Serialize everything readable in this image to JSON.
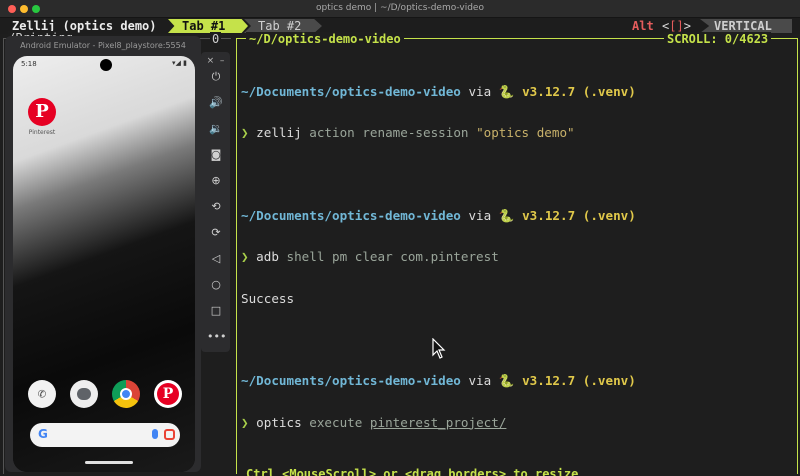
{
  "window": {
    "title": "optics demo | ~/D/optics-demo-video"
  },
  "zellij": {
    "session": "Zellij (optics demo)",
    "tabs": [
      {
        "label": "Tab #1",
        "active": true
      },
      {
        "label": "Tab #2",
        "active": false
      }
    ],
    "alt_label": "Alt",
    "alt_bracket_open": "<",
    "alt_bracket_inner": "[]",
    "alt_bracket_close": ">",
    "mode": "VERTICAL"
  },
  "left_pane": {
    "title": "/Printing",
    "zero": "0"
  },
  "emulator": {
    "title": "Android Emulator - Pixel8_playstore:5554",
    "time": "5:18",
    "status_right": "▾◢ ▮",
    "app_label": "Pinterest",
    "close": "×",
    "minimize": "–"
  },
  "terminal": {
    "pane_title": "~/D/optics-demo-video",
    "scroll": "SCROLL:  0/4623",
    "footer": "Ctrl <MouseScroll> or <drag borders> to resize",
    "lines": [
      {
        "path": "~/Documents/optics-demo-video",
        "via": " via ",
        "snake": "🐍",
        "py": " v3.12.7 (.venv)"
      },
      {
        "prompt": "❯ ",
        "cmd": "zellij",
        "args": " action rename-session ",
        "str": "\"optics demo\""
      },
      {
        "blank": ""
      },
      {
        "path": "~/Documents/optics-demo-video",
        "via": " via ",
        "snake": "🐍",
        "py": " v3.12.7 (.venv)"
      },
      {
        "prompt": "❯ ",
        "cmd": "adb",
        "args": " shell pm clear com.pinterest"
      },
      {
        "out": "Success"
      },
      {
        "blank": ""
      },
      {
        "path": "~/Documents/optics-demo-video",
        "via": " via ",
        "snake": "🐍",
        "py": " v3.12.7 (.venv)"
      },
      {
        "prompt": "❯ ",
        "cmd": "optics",
        "args": " execute ",
        "link": "pinterest_project/"
      }
    ]
  },
  "colors": {
    "accent": "#c5e24a",
    "path": "#71b7d6",
    "python": "#e0c84a",
    "pinterest": "#e60023"
  }
}
